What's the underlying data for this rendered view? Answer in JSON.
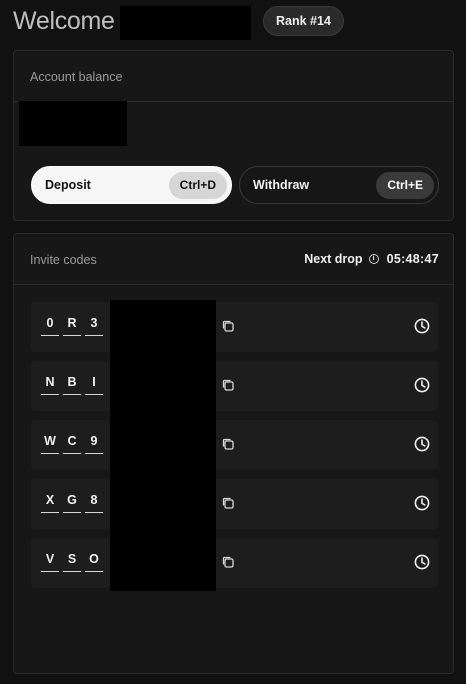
{
  "header": {
    "welcome": "Welcome",
    "rank": "Rank #14"
  },
  "balance": {
    "title": "Account balance",
    "deposit_label": "Deposit",
    "deposit_shortcut": "Ctrl+D",
    "withdraw_label": "Withdraw",
    "withdraw_shortcut": "Ctrl+E"
  },
  "invite": {
    "title": "Invite codes",
    "next_drop_label": "Next drop",
    "next_drop_time": "05:48:47",
    "codes": [
      {
        "c1": "0",
        "c2": "R",
        "c3": "3"
      },
      {
        "c1": "N",
        "c2": "B",
        "c3": "I"
      },
      {
        "c1": "W",
        "c2": "C",
        "c3": "9"
      },
      {
        "c1": "X",
        "c2": "G",
        "c3": "8"
      },
      {
        "c1": "V",
        "c2": "S",
        "c3": "O"
      }
    ]
  },
  "icons": [
    "info-icon",
    "copy-icon",
    "clock-icon"
  ],
  "colors": {
    "background": "#111111",
    "panel": "#171717",
    "deposit_bg": "#f6f6f6"
  }
}
